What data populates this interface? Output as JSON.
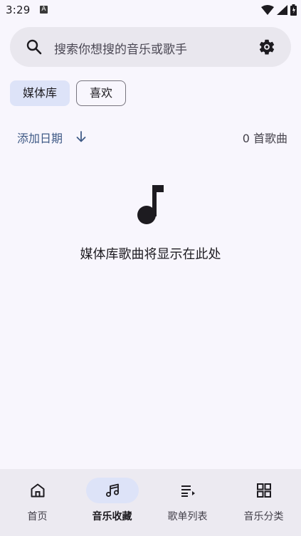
{
  "status_bar": {
    "time": "3:29",
    "notification_badge": "A",
    "icons": [
      "wifi-icon",
      "signal-icon",
      "battery-icon"
    ]
  },
  "search": {
    "placeholder": "搜索你想搜的音乐或歌手",
    "left_icon": "search-icon",
    "right_icon": "settings-icon"
  },
  "chips": [
    {
      "label": "媒体库",
      "selected": true
    },
    {
      "label": "喜欢",
      "selected": false
    }
  ],
  "sort": {
    "label": "添加日期",
    "direction_icon": "arrow-down-icon",
    "count_text": "0 首歌曲"
  },
  "empty_state": {
    "icon": "music-note-icon",
    "message": "媒体库歌曲将显示在此处"
  },
  "bottom_nav": {
    "items": [
      {
        "label": "首页",
        "icon": "home-icon",
        "active": false
      },
      {
        "label": "音乐收藏",
        "icon": "music-notes-icon",
        "active": true
      },
      {
        "label": "歌单列表",
        "icon": "playlist-icon",
        "active": false
      },
      {
        "label": "音乐分类",
        "icon": "grid-icon",
        "active": false
      }
    ]
  },
  "colors": {
    "background": "#f8f6fd",
    "search_bg": "#e9e7ee",
    "accent_container": "#dde3f8",
    "accent_text": "#3f5a86",
    "nav_bg": "#eceaf1"
  }
}
